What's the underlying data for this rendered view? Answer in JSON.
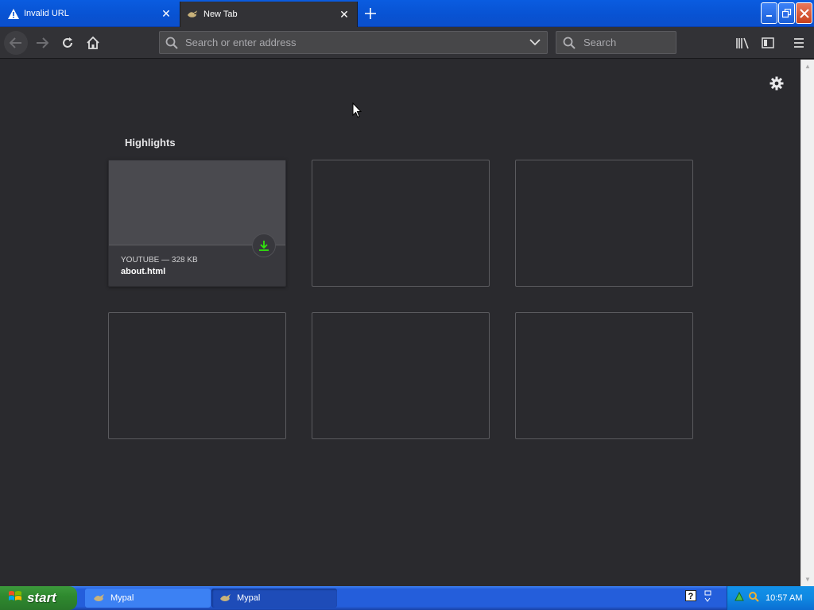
{
  "tabs": [
    {
      "title": "Invalid URL",
      "icon": "warning-icon",
      "active": false
    },
    {
      "title": "New Tab",
      "icon": "mypal-bird-icon",
      "active": true
    }
  ],
  "navbar": {
    "url_placeholder": "Search or enter address",
    "search_placeholder": "Search"
  },
  "content": {
    "section_title": "Highlights",
    "highlight": {
      "context": "YOUTUBE — 328 KB",
      "filename": "about.html"
    }
  },
  "taskbar": {
    "start_label": "start",
    "tasks": [
      {
        "label": "Mypal"
      },
      {
        "label": "Mypal"
      }
    ],
    "clock": "10:57 AM"
  },
  "colors": {
    "content_bg": "#2a2a2e",
    "toolbar_bg": "#323236",
    "xp_blue": "#245edb",
    "download_green": "#30e60b"
  }
}
